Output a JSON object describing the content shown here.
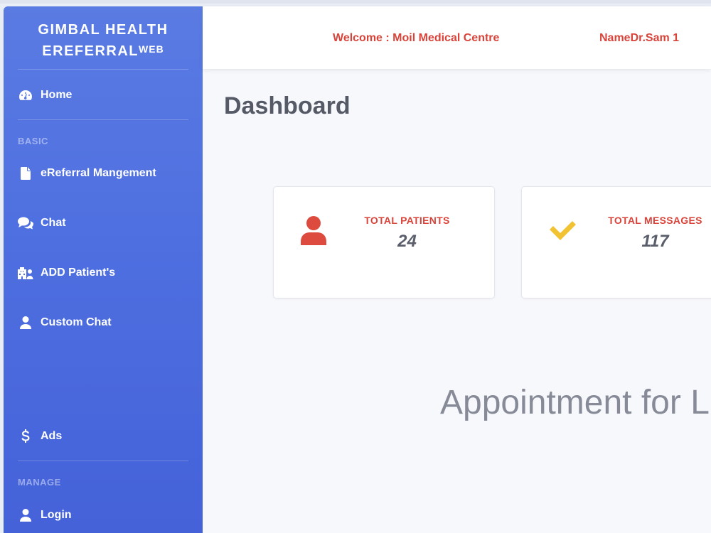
{
  "brand": {
    "line1": "GIMBAL HEALTH",
    "line2": "EREFERRAL",
    "sup": "WEB"
  },
  "sidebar": {
    "home": "Home",
    "section_basic": "BASIC",
    "items": [
      {
        "label": "eReferral Mangement",
        "icon": "file-icon"
      },
      {
        "label": "Chat",
        "icon": "chat-icon"
      },
      {
        "label": "ADD Patient's",
        "icon": "hospital-user-icon"
      },
      {
        "label": "Custom Chat",
        "icon": "user-icon"
      }
    ],
    "ads": "Ads",
    "section_manage": "MANAGE",
    "login": "Login"
  },
  "header": {
    "welcome": "Welcome : Moil Medical Centre",
    "name": "NameDr.Sam 1"
  },
  "page": {
    "title": "Dashboard"
  },
  "cards": [
    {
      "label": "TOTAL PATIENTS",
      "value": "24",
      "icon": "user-icon",
      "color": "#d9433a"
    },
    {
      "label": "TOTAL MESSAGES",
      "value": "117",
      "icon": "check-icon",
      "color": "#f1c232"
    }
  ],
  "appointment_heading": "Appointment for L"
}
